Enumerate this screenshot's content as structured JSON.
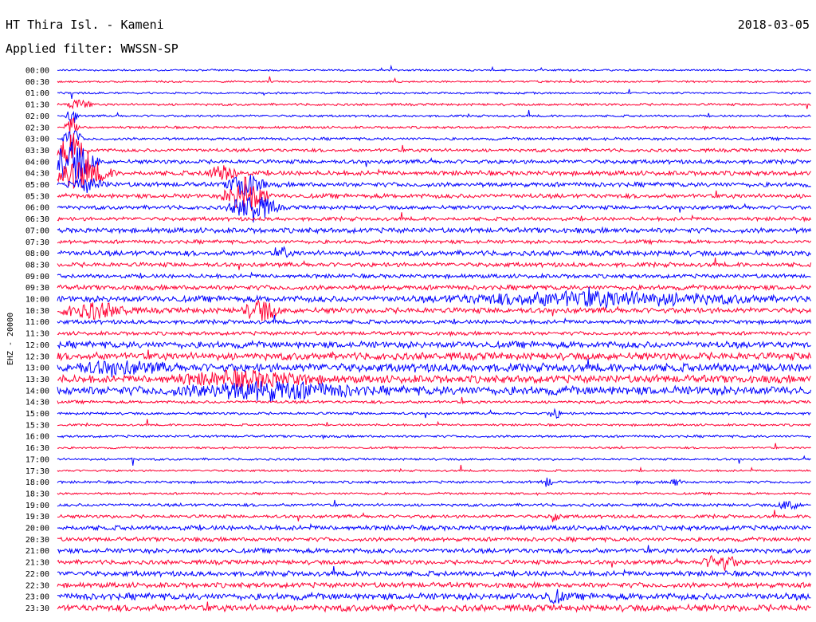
{
  "header": {
    "station": "HT Thira Isl. - Kameni",
    "date": "2018-03-05",
    "filter": "Applied filter: WWSSN-SP"
  },
  "colors": {
    "trace_a": "#0000ff",
    "trace_b": "#ff0033",
    "background": "#ffffff",
    "text": "#000000"
  },
  "chart_data": {
    "type": "line",
    "title": "HT Thira Isl. - Kameni",
    "subtitle": "Applied filter: WWSSN-SP",
    "ylabel": "EHZ - 20000",
    "xlabel": "",
    "grid": false,
    "ticks": [
      "00:00",
      "00:30",
      "01:00",
      "01:30",
      "02:00",
      "02:30",
      "03:00",
      "03:30",
      "04:00",
      "04:30",
      "05:00",
      "05:30",
      "06:00",
      "06:30",
      "07:00",
      "07:30",
      "08:00",
      "08:30",
      "09:00",
      "09:30",
      "10:00",
      "10:30",
      "11:00",
      "11:30",
      "12:00",
      "12:30",
      "13:00",
      "13:30",
      "14:00",
      "14:30",
      "15:00",
      "15:30",
      "16:00",
      "16:30",
      "17:00",
      "17:30",
      "18:00",
      "18:30",
      "19:00",
      "19:30",
      "20:00",
      "20:30",
      "21:00",
      "21:30",
      "22:00",
      "22:30",
      "23:00",
      "23:30"
    ],
    "rows": [
      {
        "time": "00:00",
        "noise": 1.0
      },
      {
        "time": "00:30",
        "noise": 1.0
      },
      {
        "time": "01:00",
        "noise": 1.1
      },
      {
        "time": "01:30",
        "noise": 1.3,
        "events": [
          {
            "pos": 0.03,
            "amp": 7,
            "width": 0.02
          }
        ]
      },
      {
        "time": "02:00",
        "noise": 1.2,
        "events": [
          {
            "pos": 0.02,
            "amp": 12,
            "width": 0.01
          }
        ]
      },
      {
        "time": "02:30",
        "noise": 1.3,
        "events": [
          {
            "pos": 0.02,
            "amp": 14,
            "width": 0.01
          }
        ]
      },
      {
        "time": "03:00",
        "noise": 1.5,
        "events": [
          {
            "pos": 0.02,
            "amp": 16,
            "width": 0.015
          }
        ]
      },
      {
        "time": "03:30",
        "noise": 1.8,
        "events": [
          {
            "pos": 0.02,
            "amp": 22,
            "width": 0.025
          }
        ]
      },
      {
        "time": "04:00",
        "noise": 2.2,
        "events": [
          {
            "pos": 0.02,
            "amp": 26,
            "width": 0.04
          }
        ]
      },
      {
        "time": "04:30",
        "noise": 2.5,
        "events": [
          {
            "pos": 0.03,
            "amp": 20,
            "width": 0.05
          },
          {
            "pos": 0.22,
            "amp": 9,
            "width": 0.03
          }
        ]
      },
      {
        "time": "05:00",
        "noise": 2.5,
        "events": [
          {
            "pos": 0.04,
            "amp": 8,
            "width": 0.03
          },
          {
            "pos": 0.25,
            "amp": 16,
            "width": 0.03
          }
        ]
      },
      {
        "time": "05:30",
        "noise": 2.4,
        "events": [
          {
            "pos": 0.25,
            "amp": 24,
            "width": 0.035
          }
        ]
      },
      {
        "time": "06:00",
        "noise": 2.2,
        "events": [
          {
            "pos": 0.26,
            "amp": 18,
            "width": 0.04
          }
        ]
      },
      {
        "time": "06:30",
        "noise": 2.0
      },
      {
        "time": "07:00",
        "noise": 2.8
      },
      {
        "time": "07:30",
        "noise": 2.0
      },
      {
        "time": "08:00",
        "noise": 2.8,
        "events": [
          {
            "pos": 0.3,
            "amp": 7,
            "width": 0.01
          }
        ]
      },
      {
        "time": "08:30",
        "noise": 2.4
      },
      {
        "time": "09:00",
        "noise": 2.2
      },
      {
        "time": "09:30",
        "noise": 2.6
      },
      {
        "time": "10:00",
        "noise": 3.4,
        "events": [
          {
            "pos": 0.72,
            "amp": 8,
            "width": 0.25
          }
        ]
      },
      {
        "time": "10:30",
        "noise": 3.0,
        "events": [
          {
            "pos": 0.05,
            "amp": 9,
            "width": 0.06
          },
          {
            "pos": 0.27,
            "amp": 13,
            "width": 0.03
          }
        ]
      },
      {
        "time": "11:00",
        "noise": 2.2
      },
      {
        "time": "11:30",
        "noise": 2.0
      },
      {
        "time": "12:00",
        "noise": 3.6
      },
      {
        "time": "12:30",
        "noise": 4.0
      },
      {
        "time": "13:00",
        "noise": 4.6,
        "events": [
          {
            "pos": 0.08,
            "amp": 6,
            "width": 0.08
          }
        ]
      },
      {
        "time": "13:30",
        "noise": 4.2,
        "events": [
          {
            "pos": 0.25,
            "amp": 8,
            "width": 0.12
          }
        ]
      },
      {
        "time": "14:00",
        "noise": 4.8,
        "events": [
          {
            "pos": 0.28,
            "amp": 9,
            "width": 0.15
          }
        ]
      },
      {
        "time": "14:30",
        "noise": 1.6
      },
      {
        "time": "15:00",
        "noise": 1.4,
        "events": [
          {
            "pos": 0.66,
            "amp": 7,
            "width": 0.01
          }
        ]
      },
      {
        "time": "15:30",
        "noise": 1.2
      },
      {
        "time": "16:00",
        "noise": 1.3
      },
      {
        "time": "16:30",
        "noise": 1.1
      },
      {
        "time": "17:00",
        "noise": 1.2,
        "events": [
          {
            "pos": 0.1,
            "amp": 14,
            "width": 0.002
          }
        ]
      },
      {
        "time": "17:30",
        "noise": 1.1
      },
      {
        "time": "18:00",
        "noise": 1.4,
        "events": [
          {
            "pos": 0.65,
            "amp": 6,
            "width": 0.01
          },
          {
            "pos": 0.82,
            "amp": 6,
            "width": 0.01
          }
        ]
      },
      {
        "time": "18:30",
        "noise": 1.2
      },
      {
        "time": "19:00",
        "noise": 1.6,
        "events": [
          {
            "pos": 0.97,
            "amp": 6,
            "width": 0.02
          }
        ]
      },
      {
        "time": "19:30",
        "noise": 1.8,
        "events": [
          {
            "pos": 0.66,
            "amp": 8,
            "width": 0.01
          }
        ]
      },
      {
        "time": "20:00",
        "noise": 2.6
      },
      {
        "time": "20:30",
        "noise": 2.2
      },
      {
        "time": "21:00",
        "noise": 2.6
      },
      {
        "time": "21:30",
        "noise": 2.4,
        "events": [
          {
            "pos": 0.88,
            "amp": 10,
            "width": 0.03
          }
        ]
      },
      {
        "time": "22:00",
        "noise": 2.8
      },
      {
        "time": "22:30",
        "noise": 2.8
      },
      {
        "time": "23:00",
        "noise": 3.6,
        "events": [
          {
            "pos": 0.66,
            "amp": 7,
            "width": 0.02
          }
        ]
      },
      {
        "time": "23:30",
        "noise": 3.6
      }
    ]
  }
}
